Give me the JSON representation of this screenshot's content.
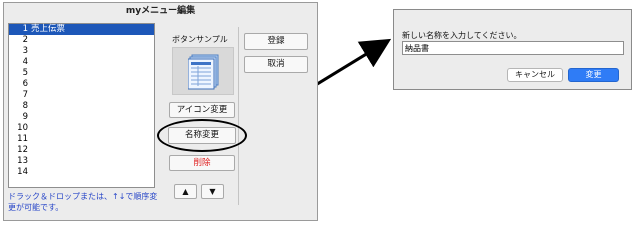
{
  "main_dialog": {
    "title": "myメニュー編集",
    "list_items": [
      {
        "num": "1",
        "name": "売上伝票"
      },
      {
        "num": "2",
        "name": ""
      },
      {
        "num": "3",
        "name": ""
      },
      {
        "num": "4",
        "name": ""
      },
      {
        "num": "5",
        "name": ""
      },
      {
        "num": "6",
        "name": ""
      },
      {
        "num": "7",
        "name": ""
      },
      {
        "num": "8",
        "name": ""
      },
      {
        "num": "9",
        "name": ""
      },
      {
        "num": "10",
        "name": ""
      },
      {
        "num": "11",
        "name": ""
      },
      {
        "num": "12",
        "name": ""
      },
      {
        "num": "13",
        "name": ""
      },
      {
        "num": "14",
        "name": ""
      }
    ],
    "hint_line1": "ドラック＆ドロップまたは、↑↓で順序変",
    "hint_line2": "更が可能です。",
    "sample_label": "ボタンサンプル",
    "icon_change_label": "アイコン変更",
    "rename_label": "名称変更",
    "delete_label": "削除",
    "up_label": "▲",
    "down_label": "▼",
    "register_label": "登録",
    "cancel_label": "取消",
    "delete_color": "#e02020",
    "selection_color": "#1d57b8"
  },
  "rename_dialog": {
    "prompt": "新しい名称を入力してください。",
    "input_value": "納品書",
    "cancel_label": "キャンセル",
    "ok_label": "変更",
    "ok_color": "#2f7cf6"
  }
}
